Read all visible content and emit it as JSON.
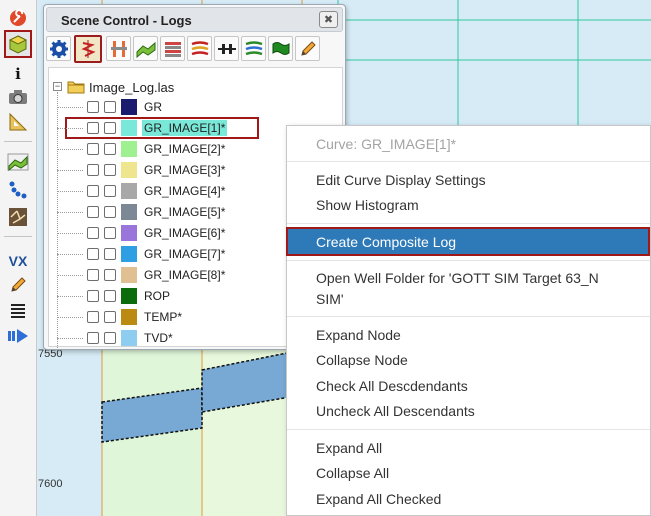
{
  "panel": {
    "title": "Scene Control - Logs",
    "close_label": "✖"
  },
  "tree": {
    "root_expander": "−",
    "root_label": "Image_Log.las",
    "curves": [
      {
        "label": "GR",
        "color": "#1a1a6e"
      },
      {
        "label": "GR_IMAGE[1]*",
        "color": "#79e8d8"
      },
      {
        "label": "GR_IMAGE[2]*",
        "color": "#9ef091"
      },
      {
        "label": "GR_IMAGE[3]*",
        "color": "#efe58f"
      },
      {
        "label": "GR_IMAGE[4]*",
        "color": "#a8a8a8"
      },
      {
        "label": "GR_IMAGE[5]*",
        "color": "#7d8896"
      },
      {
        "label": "GR_IMAGE[6]*",
        "color": "#9a76dc"
      },
      {
        "label": "GR_IMAGE[7]*",
        "color": "#2f9fe3"
      },
      {
        "label": "GR_IMAGE[8]*",
        "color": "#e0bf92"
      },
      {
        "label": "ROP",
        "color": "#0c6b0c"
      },
      {
        "label": "TEMP*",
        "color": "#bb8a12"
      },
      {
        "label": "TVD*",
        "color": "#8fcdf0"
      }
    ]
  },
  "context_menu": {
    "header": "Curve: GR_IMAGE[1]*",
    "edit_display": "Edit Curve Display Settings",
    "show_histogram": "Show Histogram",
    "create_composite": "Create Composite Log",
    "open_well_folder_line1": "Open Well Folder for 'GOTT SIM Target 63_N",
    "open_well_folder_line2": "SIM'",
    "expand_node": "Expand Node",
    "collapse_node": "Collapse Node",
    "check_all": "Check All Descdendants",
    "uncheck_all": "Uncheck All Descendants",
    "expand_all": "Expand All",
    "collapse_all": "Collapse All",
    "expand_all_checked": "Expand All Checked"
  },
  "plot": {
    "depth_labels": [
      "7550",
      "7600"
    ]
  },
  "left_toolbar": {
    "info_glyph": "i",
    "vx_label": "VX"
  }
}
